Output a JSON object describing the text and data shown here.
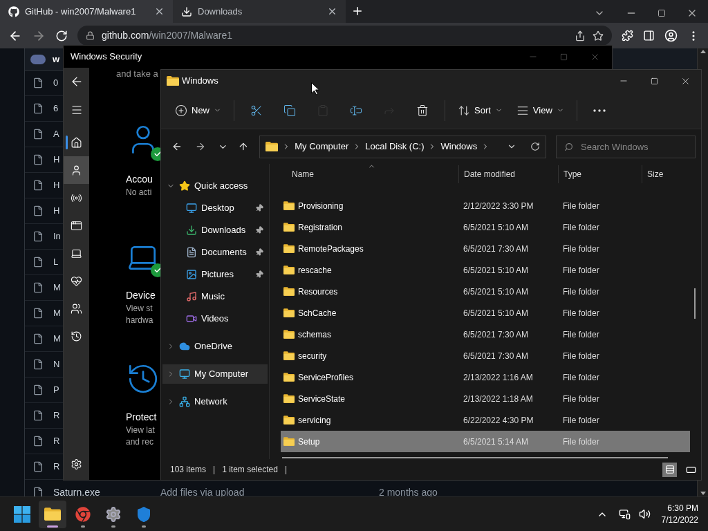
{
  "browser": {
    "tabs": [
      {
        "kind": "github",
        "title": "GitHub - win2007/Malware1",
        "selected": true
      },
      {
        "kind": "download",
        "title": "Downloads",
        "selected": false
      }
    ],
    "address": {
      "host": "github.com",
      "path": "/win2007/Malware1"
    }
  },
  "repo_page": {
    "owner_initial": "w",
    "files": [
      "0",
      "6",
      "A",
      "H",
      "H",
      "H",
      "In",
      "L",
      "M",
      "M",
      "M",
      "N",
      "P",
      "R",
      "R",
      "R"
    ],
    "last_file": {
      "name": "Saturn.exe",
      "message": "Add files via upload",
      "age": "2 months ago"
    }
  },
  "security": {
    "title": "Windows Security",
    "intro": "and take a",
    "nav": [
      {
        "kind": "home",
        "selected": true,
        "hovered": false
      },
      {
        "kind": "account",
        "selected": false,
        "hovered": true
      },
      {
        "kind": "firewall",
        "selected": false,
        "hovered": false
      },
      {
        "kind": "app",
        "selected": false,
        "hovered": false
      },
      {
        "kind": "device",
        "selected": false,
        "hovered": false
      },
      {
        "kind": "health",
        "selected": false,
        "hovered": false
      },
      {
        "kind": "family",
        "selected": false,
        "hovered": false
      },
      {
        "kind": "history",
        "selected": false,
        "hovered": false
      }
    ],
    "cards": [
      {
        "kind": "account",
        "title": "Accou",
        "lines": [
          "No acti"
        ],
        "ok": true
      },
      {
        "kind": "device",
        "title": "Device",
        "lines": [
          "View st",
          "hardwa"
        ],
        "ok": true
      },
      {
        "kind": "history",
        "title": "Protect",
        "lines": [
          "View lat",
          "and rec"
        ],
        "ok": false
      }
    ]
  },
  "explorer": {
    "title": "Windows",
    "toolbar": [
      {
        "kind": "new",
        "label": "New",
        "disabled": false
      },
      {
        "kind": "cut",
        "disabled": false
      },
      {
        "kind": "copy",
        "disabled": false
      },
      {
        "kind": "paste",
        "disabled": true
      },
      {
        "kind": "rename",
        "disabled": false
      },
      {
        "kind": "share",
        "disabled": true
      },
      {
        "kind": "delete",
        "disabled": false
      },
      {
        "kind": "sort",
        "label": "Sort",
        "disabled": false
      },
      {
        "kind": "view",
        "label": "View",
        "disabled": false
      },
      {
        "kind": "more",
        "disabled": false
      }
    ],
    "breadcrumb": [
      "My Computer",
      "Local Disk (C:)",
      "Windows"
    ],
    "search": {
      "placeholder": "Search Windows"
    },
    "tree": [
      {
        "kind": "star",
        "label": "Quick access",
        "expanded": true,
        "selected": false,
        "children": [
          {
            "kind": "desktop",
            "label": "Desktop",
            "pinned": true,
            "selected": false
          },
          {
            "kind": "downloads",
            "label": "Downloads",
            "pinned": true,
            "selected": false
          },
          {
            "kind": "documents",
            "label": "Documents",
            "pinned": true,
            "selected": false
          },
          {
            "kind": "pictures",
            "label": "Pictures",
            "pinned": true,
            "selected": false
          },
          {
            "kind": "music",
            "label": "Music",
            "pinned": false,
            "selected": false
          },
          {
            "kind": "videos",
            "label": "Videos",
            "pinned": false,
            "selected": false
          }
        ]
      },
      {
        "kind": "cloud",
        "label": "OneDrive",
        "expanded": false,
        "selected": false
      },
      {
        "kind": "computer",
        "label": "My Computer",
        "expanded": false,
        "selected": true
      },
      {
        "kind": "network",
        "label": "Network",
        "expanded": false,
        "selected": false
      }
    ],
    "columns": [
      "Name",
      "Date modified",
      "Type",
      "Size"
    ],
    "rows": [
      {
        "name": "Provisioning",
        "date": "2/12/2022 3:30 PM",
        "type": "File folder",
        "selected": false
      },
      {
        "name": "Registration",
        "date": "6/5/2021 5:10 AM",
        "type": "File folder",
        "selected": false
      },
      {
        "name": "RemotePackages",
        "date": "6/5/2021 7:30 AM",
        "type": "File folder",
        "selected": false
      },
      {
        "name": "rescache",
        "date": "6/5/2021 5:10 AM",
        "type": "File folder",
        "selected": false
      },
      {
        "name": "Resources",
        "date": "6/5/2021 5:10 AM",
        "type": "File folder",
        "selected": false
      },
      {
        "name": "SchCache",
        "date": "6/5/2021 5:10 AM",
        "type": "File folder",
        "selected": false
      },
      {
        "name": "schemas",
        "date": "6/5/2021 7:30 AM",
        "type": "File folder",
        "selected": false
      },
      {
        "name": "security",
        "date": "6/5/2021 7:30 AM",
        "type": "File folder",
        "selected": false
      },
      {
        "name": "ServiceProfiles",
        "date": "2/13/2022 1:16 AM",
        "type": "File folder",
        "selected": false
      },
      {
        "name": "ServiceState",
        "date": "2/13/2022 1:18 AM",
        "type": "File folder",
        "selected": false
      },
      {
        "name": "servicing",
        "date": "6/22/2022 4:30 PM",
        "type": "File folder",
        "selected": false
      },
      {
        "name": "Setup",
        "date": "6/5/2021 5:14 AM",
        "type": "File folder",
        "selected": true
      }
    ],
    "status": [
      "103 items",
      "|",
      "1 item selected",
      "|"
    ],
    "views": [
      {
        "kind": "details",
        "selected": true
      },
      {
        "kind": "tiles",
        "selected": false
      }
    ]
  },
  "taskbar": {
    "apps": [
      {
        "kind": "explorer",
        "active": true
      },
      {
        "kind": "chrome",
        "active": false
      },
      {
        "kind": "settings",
        "active": false
      },
      {
        "kind": "security",
        "active": false
      }
    ],
    "time": "6:30 PM",
    "date": "7/12/2022"
  }
}
